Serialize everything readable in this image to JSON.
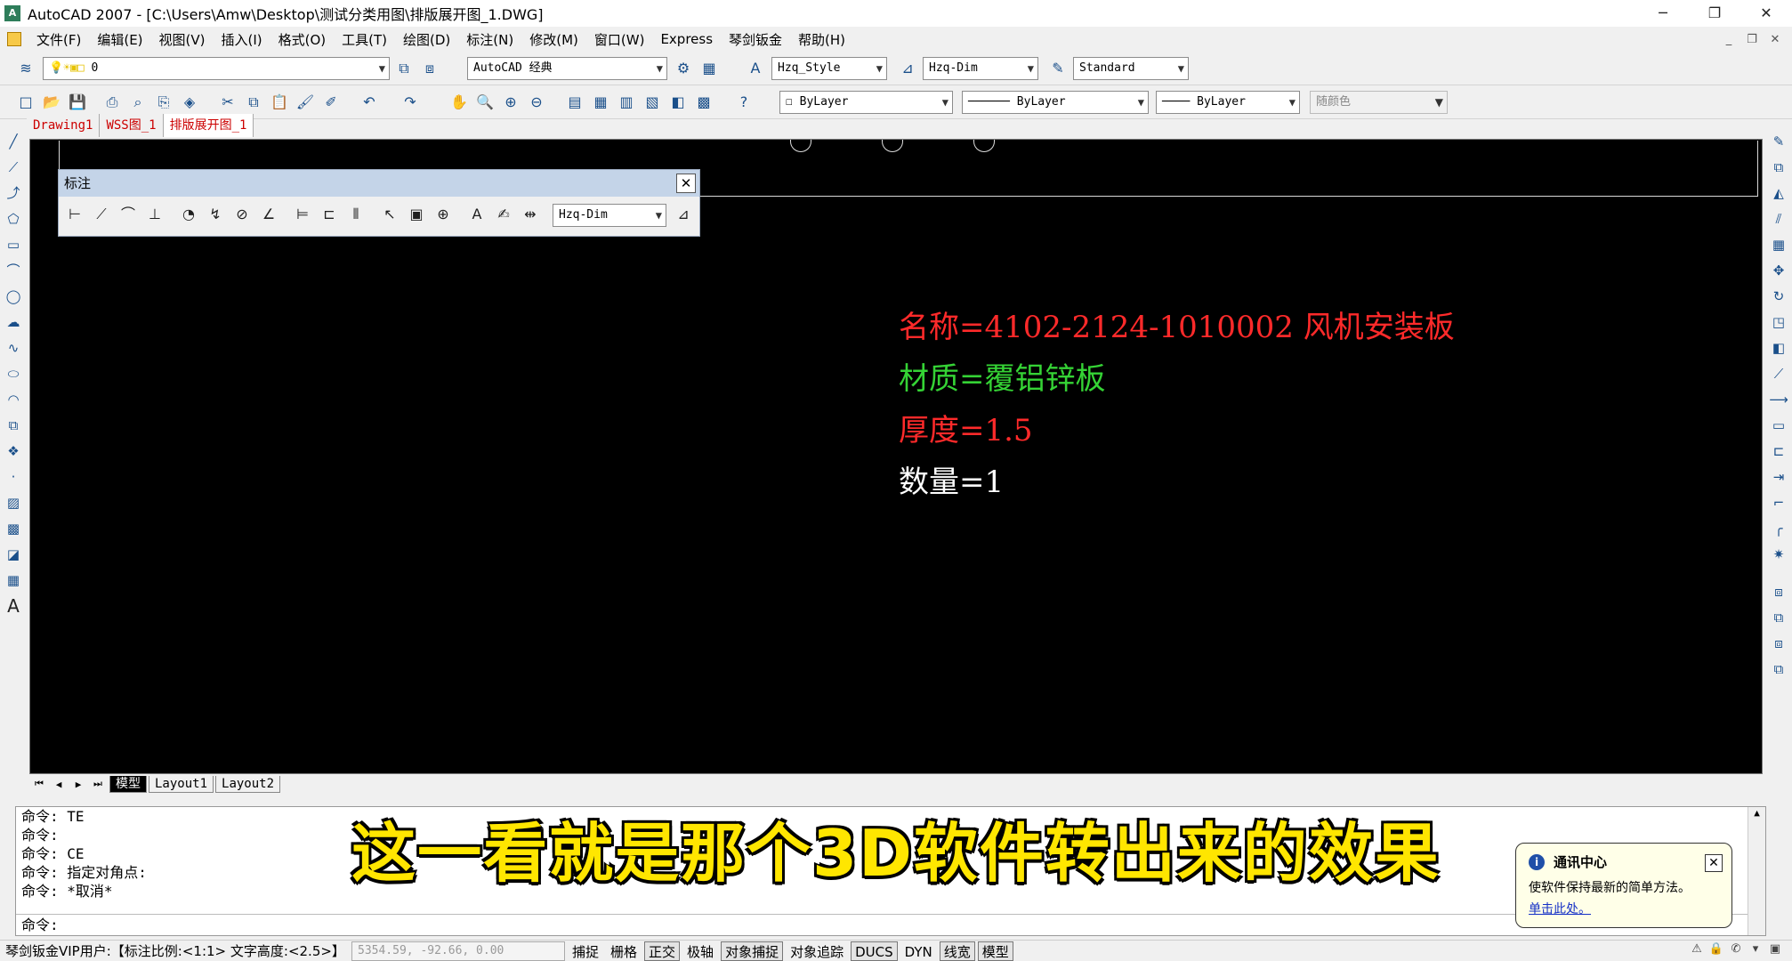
{
  "window": {
    "title": "AutoCAD 2007 - [C:\\Users\\Amw\\Desktop\\测试分类用图\\排版展开图_1.DWG]",
    "app_icon": "autocad-icon",
    "controls": [
      "─",
      "❐",
      "✕"
    ]
  },
  "menu": {
    "items": [
      "文件(F)",
      "编辑(E)",
      "视图(V)",
      "插入(I)",
      "格式(O)",
      "工具(T)",
      "绘图(D)",
      "标注(N)",
      "修改(M)",
      "窗口(W)",
      "Express",
      "琴剑钣金",
      "帮助(H)"
    ],
    "mdi_controls": [
      "_",
      "❐",
      "✕"
    ]
  },
  "toolbar1": {
    "layer_value": "0",
    "workspace_value": "AutoCAD 经典",
    "text_style_value": "Hzq_Style",
    "dim_style_value": "Hzq-Dim",
    "table_style_value": "Standard"
  },
  "toolbar2": {
    "color_value": "ByLayer",
    "linetype_value": "ByLayer",
    "lineweight_value": "ByLayer",
    "plotstyle_value": "随颜色"
  },
  "doc_tabs": [
    "Drawing1",
    "WSS图_1",
    "排版展开图_1"
  ],
  "dim_toolbar": {
    "title": "标注",
    "close": "✕",
    "dimstyle_value": "Hzq-Dim"
  },
  "drawing": {
    "name_line": "名称=4102-2124-1010002  风机安装板",
    "material_line": "材质=覆铝锌板",
    "thickness_line": "厚度=1.5",
    "quantity_line": "数量=1",
    "colors": {
      "name": "#ff2a2a",
      "material": "#35d335",
      "thickness": "#ff2a2a",
      "quantity": "#ffffff"
    }
  },
  "layout_tabs": [
    "模型",
    "Layout1",
    "Layout2"
  ],
  "command": {
    "history": [
      "命令: TE",
      "命令:",
      "命令: CE",
      "命令: 指定对角点:",
      "命令: *取消*"
    ],
    "prompt": "命令:"
  },
  "subtitle": "这一看就是那个3D软件转出来的效果",
  "notification": {
    "title": "通讯中心",
    "body": "使软件保持最新的简单方法。",
    "link": "单击此处。",
    "close": "✕"
  },
  "status": {
    "info": "琴剑钣金VIP用户:【标注比例:<1:1> 文字高度:<2.5>】",
    "coords": "5354.59, -92.66, 0.00",
    "toggles": [
      "捕捉",
      "栅格",
      "正交",
      "极轴",
      "对象捕捉",
      "对象追踪",
      "DUCS",
      "DYN",
      "线宽",
      "模型"
    ]
  }
}
